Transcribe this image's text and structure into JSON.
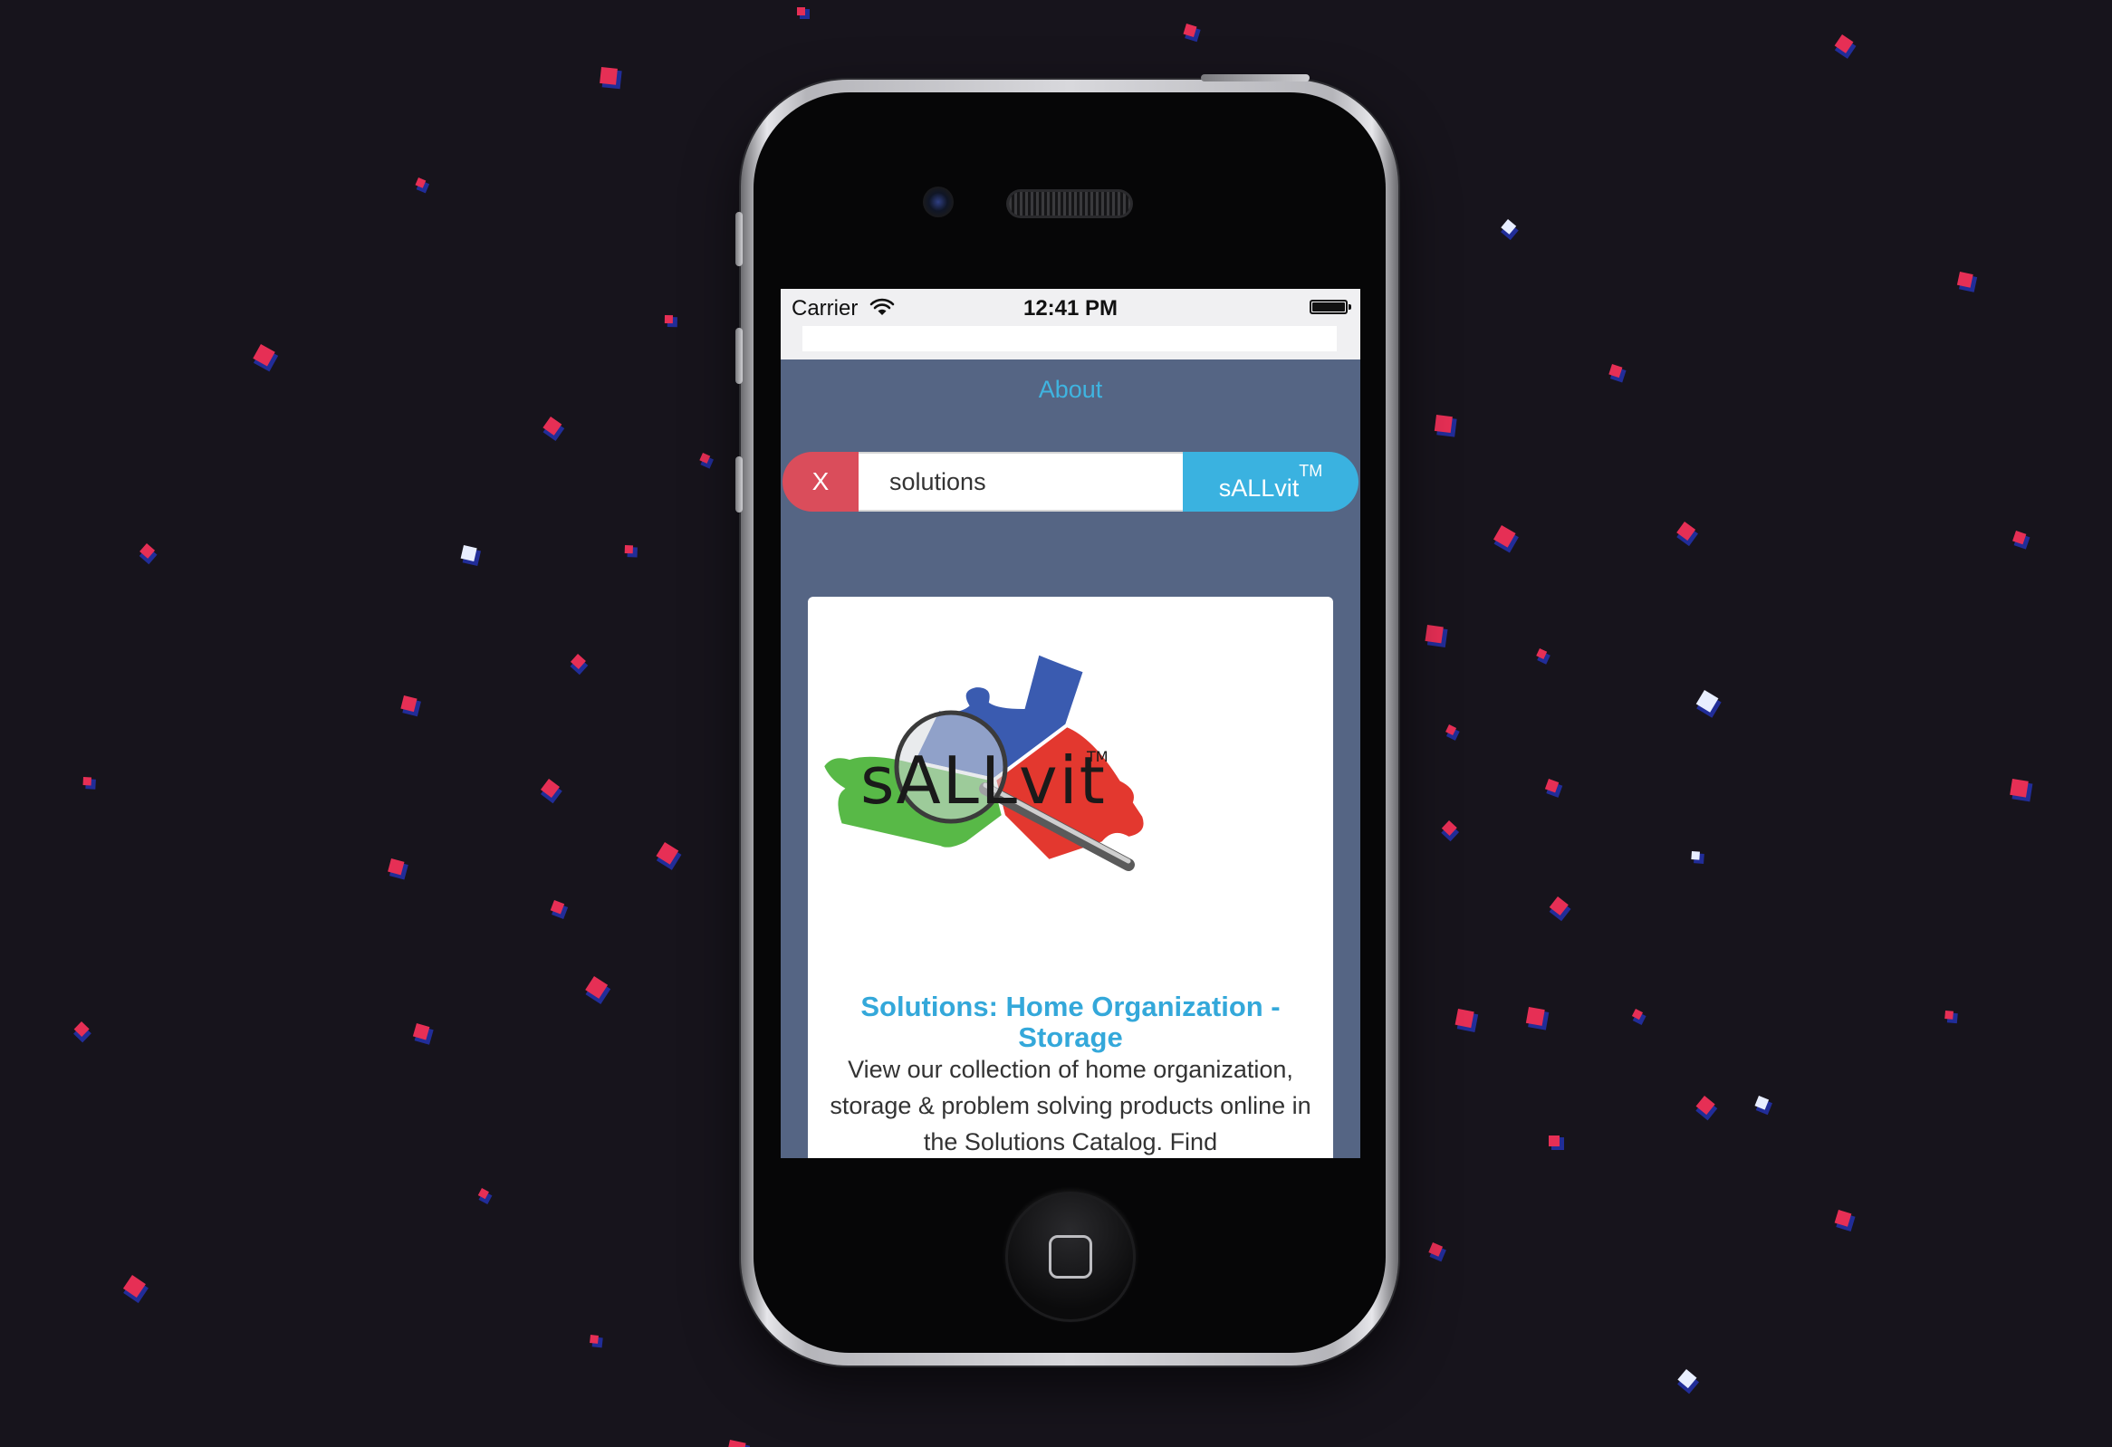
{
  "status_bar": {
    "carrier": "Carrier",
    "time": "12:41 PM"
  },
  "nav": {
    "about_label": "About"
  },
  "search": {
    "clear_label": "X",
    "query_value": "solutions",
    "button_label": "sALLvit",
    "button_trademark": "TM"
  },
  "card": {
    "logo_text": "sALLvit",
    "logo_trademark": "TM",
    "title": "Solutions: Home Organization - Storage",
    "text": "View our collection of home organization, storage & problem solving products online in the Solutions Catalog. Find"
  },
  "colors": {
    "background": "#17141c",
    "screen_background": "#556584",
    "accent_blue": "#3ab2e0",
    "clear_red": "#da4d5b",
    "puzzle_blue": "#3a5bb0",
    "puzzle_green": "#58b947",
    "puzzle_red": "#e3382f"
  },
  "icons": {
    "status": [
      "wifi-icon",
      "battery-icon"
    ],
    "logo": "magnifying-glass-icon"
  }
}
